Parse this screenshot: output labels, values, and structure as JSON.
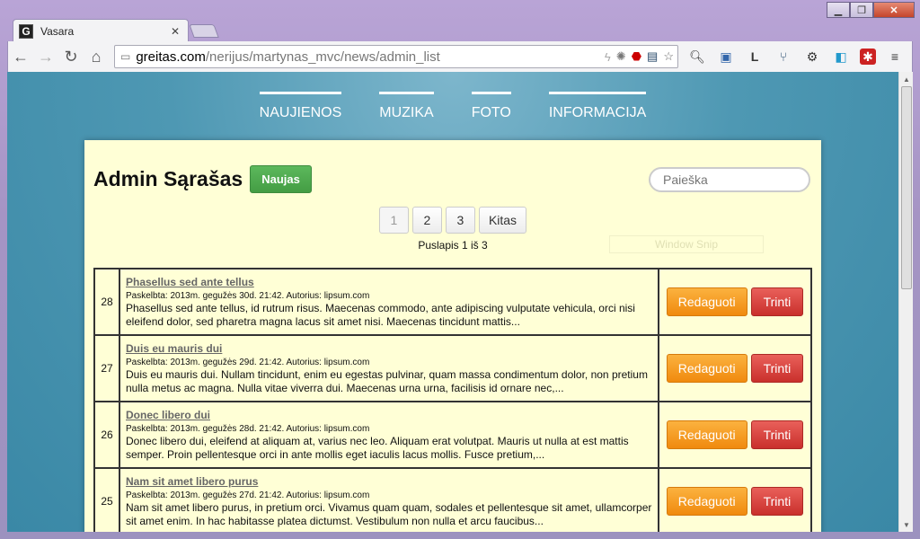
{
  "browser": {
    "tab_title": "Vasara",
    "tab_favicon": "G",
    "url_host": "greitas.com",
    "url_path": "/nerijus/martynas_mvc/news/admin_list"
  },
  "site_nav": [
    "NAUJIENOS",
    "MUZIKA",
    "FOTO",
    "INFORMACIJA"
  ],
  "page": {
    "title": "Admin Sąrašas",
    "new_button": "Naujas",
    "search_placeholder": "Paieška",
    "pager": [
      "1",
      "2",
      "3",
      "Kitas"
    ],
    "page_info": "Puslapis 1 iš 3",
    "overlay_text": "Window Snip"
  },
  "rows": [
    {
      "id": "28",
      "title": "Phasellus sed ante tellus",
      "meta": "Paskelbta: 2013m. gegužės 30d. 21:42. Autorius: lipsum.com",
      "body": "Phasellus sed ante tellus, id rutrum risus. Maecenas commodo, ante adipiscing vulputate vehicula, orci nisi eleifend dolor, sed pharetra magna lacus sit amet nisi. Maecenas tincidunt mattis...",
      "edit": "Redaguoti",
      "delete": "Trinti"
    },
    {
      "id": "27",
      "title": "Duis eu mauris dui",
      "meta": "Paskelbta: 2013m. gegužės 29d. 21:42. Autorius: lipsum.com",
      "body": "Duis eu mauris dui. Nullam tincidunt, enim eu egestas pulvinar, quam massa condimentum dolor, non pretium nulla metus ac magna. Nulla vitae viverra dui. Maecenas urna urna, facilisis id ornare nec,...",
      "edit": "Redaguoti",
      "delete": "Trinti"
    },
    {
      "id": "26",
      "title": "Donec libero dui",
      "meta": "Paskelbta: 2013m. gegužės 28d. 21:42. Autorius: lipsum.com",
      "body": "Donec libero dui, eleifend at aliquam at, varius nec leo. Aliquam erat volutpat. Mauris ut nulla at est mattis semper. Proin pellentesque orci in ante mollis eget iaculis lacus mollis. Fusce pretium,...",
      "edit": "Redaguoti",
      "delete": "Trinti"
    },
    {
      "id": "25",
      "title": "Nam sit amet libero purus",
      "meta": "Paskelbta: 2013m. gegužės 27d. 21:42. Autorius: lipsum.com",
      "body": "Nam sit amet libero purus, in pretium orci. Vivamus quam quam, sodales et pellentesque sit amet, ullamcorper sit amet enim. In hac habitasse platea dictumst. Vestibulum non nulla et arcu faucibus...",
      "edit": "Redaguoti",
      "delete": "Trinti"
    }
  ],
  "colors": {
    "new_button": "#5cb85c",
    "edit_button": "#f39c12",
    "delete_button": "#d9534f",
    "panel_bg": "#ffffd6",
    "page_bg": "#4e98b3"
  }
}
